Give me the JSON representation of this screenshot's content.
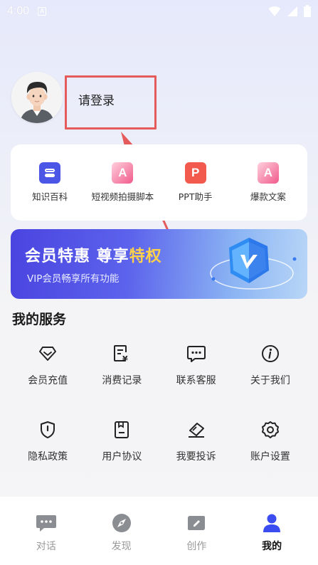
{
  "status_bar": {
    "time": "4:00",
    "notification_letter": "A"
  },
  "profile": {
    "login_text": "请登录"
  },
  "tools": [
    {
      "label": "知识百科",
      "icon": "encyclopedia-icon",
      "color": "#4b56e6"
    },
    {
      "label": "短视频拍摄脚本",
      "icon": "video-script-icon",
      "color": "#f05a8a"
    },
    {
      "label": "PPT助手",
      "icon": "ppt-icon",
      "color": "#f25a4e"
    },
    {
      "label": "爆款文案",
      "icon": "copywriting-icon",
      "color": "#f05a8a"
    }
  ],
  "vip": {
    "title_main": "会员特惠 尊享",
    "title_highlight": "特权",
    "subtitle": "VIP会员畅享所有功能"
  },
  "services_title": "我的服务",
  "services": [
    {
      "label": "会员充值",
      "icon": "diamond-icon"
    },
    {
      "label": "消费记录",
      "icon": "receipt-icon"
    },
    {
      "label": "联系客服",
      "icon": "chat-bubble-icon"
    },
    {
      "label": "关于我们",
      "icon": "info-icon"
    },
    {
      "label": "隐私政策",
      "icon": "shield-icon"
    },
    {
      "label": "用户协议",
      "icon": "document-icon"
    },
    {
      "label": "我要投诉",
      "icon": "complaint-icon"
    },
    {
      "label": "账户设置",
      "icon": "gear-icon"
    }
  ],
  "nav": [
    {
      "label": "对话",
      "icon": "dialog-icon",
      "active": false
    },
    {
      "label": "发现",
      "icon": "compass-icon",
      "active": false
    },
    {
      "label": "创作",
      "icon": "create-icon",
      "active": false
    },
    {
      "label": "我的",
      "icon": "profile-icon",
      "active": true
    }
  ],
  "colors": {
    "accent": "#3b4df0",
    "highlight_border": "#e55a5a",
    "vip_gold": "#ffd24a"
  }
}
